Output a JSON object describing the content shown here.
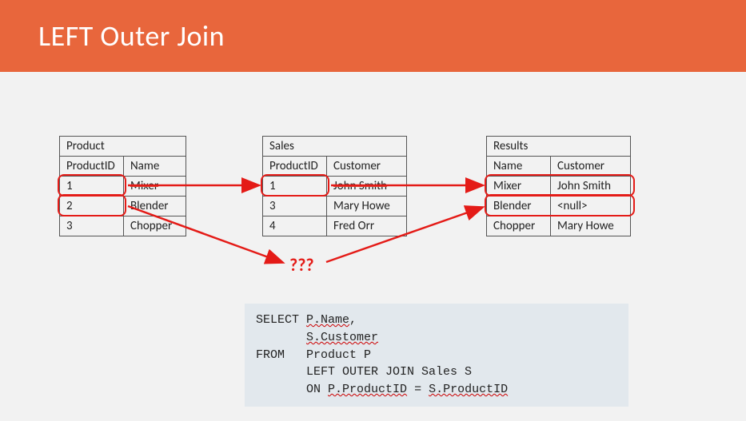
{
  "title": "LEFT Outer Join",
  "tables": {
    "product": {
      "caption": "Product",
      "headers": [
        "ProductID",
        "Name"
      ],
      "rows": [
        {
          "id": "1",
          "name": "Mixer",
          "struckName": true
        },
        {
          "id": "2",
          "name": "Blender"
        },
        {
          "id": "3",
          "name": "Chopper"
        }
      ]
    },
    "sales": {
      "caption": "Sales",
      "headers": [
        "ProductID",
        "Customer"
      ],
      "rows": [
        {
          "id": "1",
          "customer": "John Smith",
          "struckCustomer": true
        },
        {
          "id": "3",
          "customer": "Mary Howe"
        },
        {
          "id": "4",
          "customer": "Fred Orr"
        }
      ]
    },
    "results": {
      "caption": "Results",
      "headers": [
        "Name",
        "Customer"
      ],
      "rows": [
        {
          "name": "Mixer",
          "customer": "John Smith"
        },
        {
          "name": "Blender",
          "customer": "<null>"
        },
        {
          "name": "Chopper",
          "customer": "Mary Howe"
        }
      ]
    }
  },
  "question_marks": "???",
  "sql": {
    "select_kw": "SELECT",
    "select_1": "P.Name",
    "select_2": "S.Customer",
    "from_kw": "FROM",
    "from_tbl": "Product P",
    "join_line": "LEFT OUTER JOIN Sales S",
    "on_kw": "ON",
    "on_left": "P.ProductID",
    "on_eq": " = ",
    "on_right": "S.ProductID"
  },
  "colors": {
    "accent": "#e8663c",
    "highlight": "#e41b17",
    "code_bg": "#e2e8ed"
  }
}
